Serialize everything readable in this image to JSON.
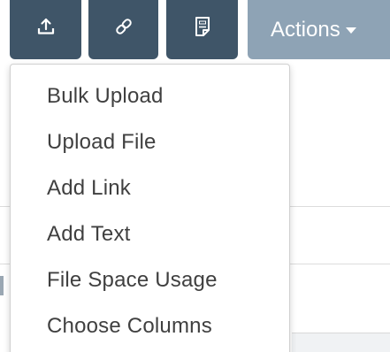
{
  "toolbar": {
    "upload_icon": "upload-icon",
    "link_icon": "link-icon",
    "doc_icon": "document-icon",
    "actions_label": "Actions",
    "colors": {
      "dark_button": "#3f5568",
      "actions_button": "#8ea3b5",
      "icon": "#ffffff"
    }
  },
  "menu": {
    "items": [
      {
        "label": "Bulk Upload"
      },
      {
        "label": "Upload File"
      },
      {
        "label": "Add Link"
      },
      {
        "label": "Add Text"
      },
      {
        "label": "File Space Usage"
      },
      {
        "label": "Choose Columns"
      }
    ],
    "text_color": "#404040"
  }
}
